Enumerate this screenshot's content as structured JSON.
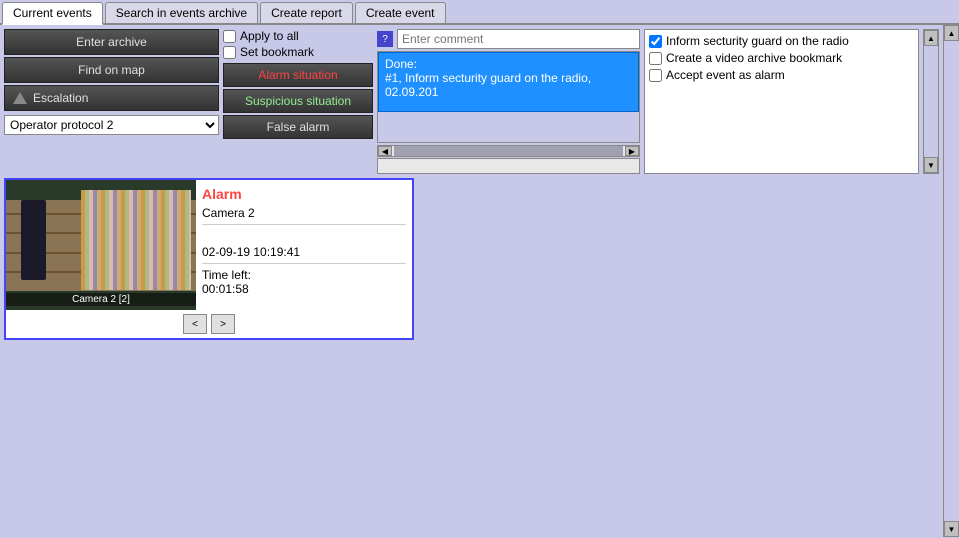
{
  "tabs": [
    {
      "label": "Current events",
      "active": true
    },
    {
      "label": "Search in events archive",
      "active": false
    },
    {
      "label": "Create report",
      "active": false
    },
    {
      "label": "Create event",
      "active": false
    }
  ],
  "leftPanel": {
    "enterArchive": "Enter archive",
    "findOnMap": "Find on map",
    "escalation": "Escalation",
    "operatorLabel": "Operator protocol 2"
  },
  "checkboxes": {
    "applyToAll": "Apply to all",
    "setBookmark": "Set bookmark"
  },
  "situationButtons": {
    "alarm": "Alarm situation",
    "suspicious": "Suspicious situation",
    "falseAlarm": "False alarm"
  },
  "comment": {
    "placeholder": "Enter comment",
    "helpLabel": "?",
    "doneLabel": "Done:",
    "doneText": "#1, Inform secturity guard on the radio, 02.09.201"
  },
  "rightCheckboxes": [
    {
      "label": "Inform secturity guard on the radio",
      "checked": true
    },
    {
      "label": "Create a video archive bookmark",
      "checked": false
    },
    {
      "label": "Accept event as alarm",
      "checked": false
    }
  ],
  "alarmCard": {
    "title": "Alarm",
    "cameraName": "Camera 2",
    "dateTime": "02-09-19 10:19:41",
    "timeLeftLabel": "Time left:",
    "timeLeftValue": "00:01:58",
    "cameraLabel": "Camera 2 [2]",
    "navPrev": "<",
    "navNext": ">"
  }
}
